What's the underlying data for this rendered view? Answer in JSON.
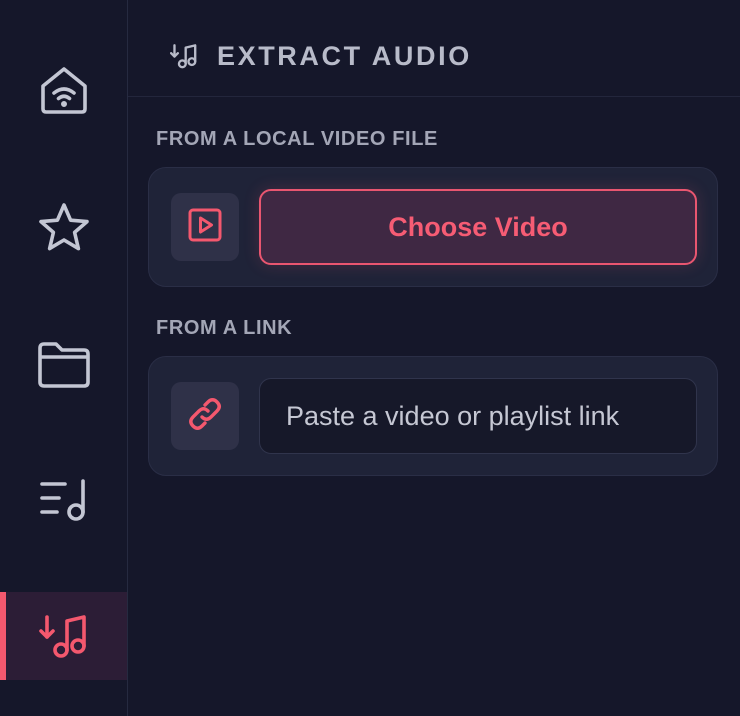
{
  "colors": {
    "background": "#15172a",
    "accent": "#f4586e",
    "text_muted": "#a3a6b6",
    "card_background": "#1f2338"
  },
  "sidebar": {
    "items": [
      {
        "icon": "home-wifi-icon",
        "active": false
      },
      {
        "icon": "star-icon",
        "active": false
      },
      {
        "icon": "folder-icon",
        "active": false
      },
      {
        "icon": "playlist-music-icon",
        "active": false
      },
      {
        "icon": "download-music-icon",
        "active": true
      }
    ]
  },
  "header": {
    "icon": "download-music-icon",
    "title": "EXTRACT AUDIO"
  },
  "local_section": {
    "label": "FROM A LOCAL VIDEO FILE",
    "icon": "play-video-icon",
    "button_label": "Choose Video"
  },
  "link_section": {
    "label": "FROM A LINK",
    "icon": "link-icon",
    "input_value": "",
    "input_placeholder": "Paste a video or playlist link"
  }
}
